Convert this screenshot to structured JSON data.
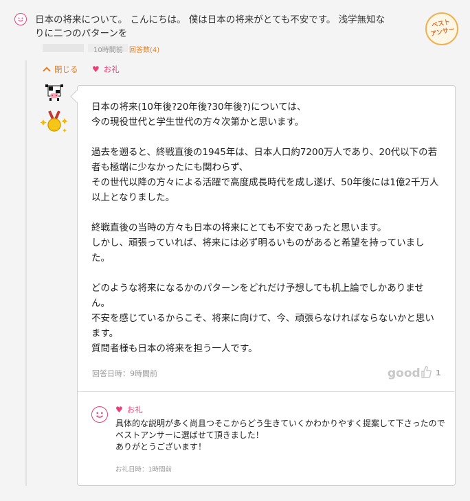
{
  "question": {
    "text": "日本の将来について。 こんにちは。 僕は日本の将来がとても不安です。 浅学無知なりに二つのパターンを",
    "time": "10時間前",
    "answer_count": "回答数(4)"
  },
  "best_answer_badge": "ベスト\nアンサー",
  "actions": {
    "close_label": "閉じる",
    "thanks_label": "お礼"
  },
  "answer": {
    "paragraphs": [
      "日本の将来(10年後?20年後?30年後?)については、\n今の現役世代と学生世代の方々次第かと思います。",
      "過去を遡ると、終戦直後の1945年は、日本人口約7200万人であり、20代以下の若者も極端に少なかったにも関わらず、\nその世代以降の方々による活躍で高度成長時代を成し遂げ、50年後には1億2千万人以上となりました。",
      "終戦直後の当時の方々も日本の将来にとても不安であったと思います。\nしかし、頑張っていれば、将来には必ず明るいものがあると希望を持っていました。",
      "どのような将来になるかのパターンをどれだけ予想しても机上論でしかありません。\n不安を感じているからこそ、将来に向けて、今、頑張らなければならないかと思います。\n質問者様も日本の将来を担う一人です。"
    ],
    "date": "回答日時：9時間前",
    "good_label": "good",
    "good_count": "1"
  },
  "reply": {
    "label": "お礼",
    "text": "具体的な説明が多く尚且つそこからどう生きていくかわかりやすく提案して下さったのでベストアンサーに選ばせて頂きました！\nありがとうございます！",
    "date": "お礼日時：1時間前"
  },
  "colors": {
    "accent_orange": "#e67e22",
    "accent_pink": "#e8417a"
  }
}
